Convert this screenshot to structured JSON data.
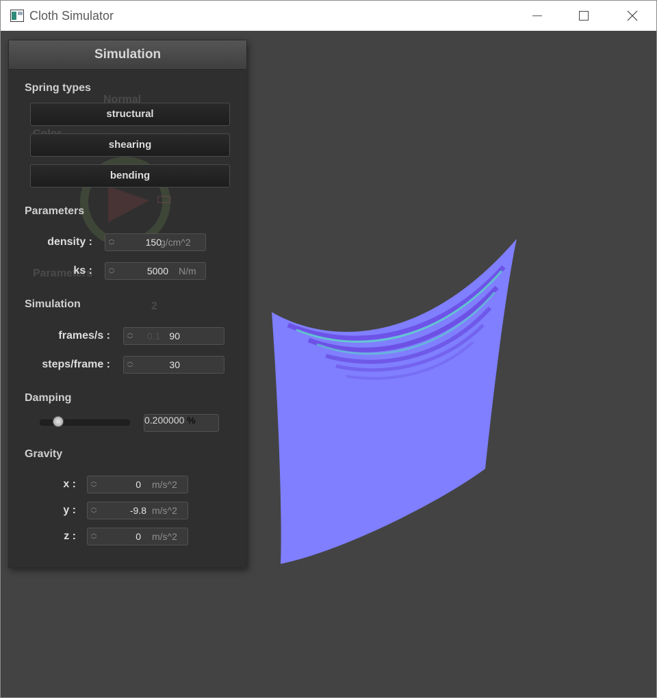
{
  "window": {
    "title": "Cloth Simulator",
    "controls": {
      "minimize": "—",
      "maximize": "☐",
      "close": "✕"
    }
  },
  "panel": {
    "title": "Simulation",
    "spring_types": {
      "heading": "Spring types",
      "buttons": [
        "structural",
        "shearing",
        "bending"
      ]
    },
    "parameters": {
      "heading": "Parameters",
      "density": {
        "label": "density :",
        "value": "150",
        "unit": "g/cm^2"
      },
      "ks": {
        "label": "ks :",
        "value": "5000",
        "unit": "N/m"
      }
    },
    "simulation": {
      "heading": "Simulation",
      "fps": {
        "label": "frames/s :",
        "value": "90"
      },
      "steps": {
        "label": "steps/frame :",
        "value": "30"
      }
    },
    "damping": {
      "heading": "Damping",
      "value": "0.200000",
      "unit": "%",
      "slider_fraction": 0.2
    },
    "gravity": {
      "heading": "Gravity",
      "x": {
        "label": "x :",
        "value": "0",
        "unit": "m/s^2"
      },
      "y": {
        "label": "y :",
        "value": "-9.8",
        "unit": "m/s^2"
      },
      "z": {
        "label": "z :",
        "value": "0",
        "unit": "m/s^2"
      }
    },
    "background_ghost": {
      "dropdown": "Normal",
      "color_label": "Color",
      "params_label": "Parameters",
      "spin1": "2",
      "spin2": "0.1"
    }
  },
  "colors": {
    "background": "#434343",
    "cloth": "#7f7fff",
    "panel": "#2e2e2e"
  }
}
